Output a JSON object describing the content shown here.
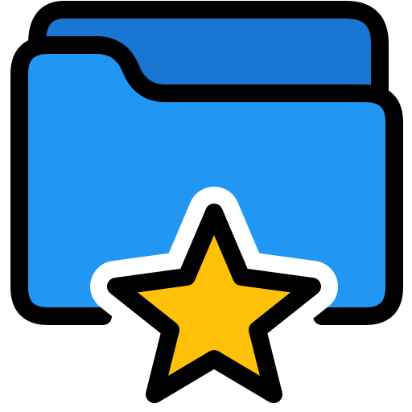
{
  "icon": {
    "name": "folder-star-icon",
    "parts": [
      "back-folder-panel",
      "front-folder",
      "star"
    ]
  },
  "colors": {
    "folder_back": "#1976D2",
    "folder_front": "#2196F3",
    "star_fill": "#FFC107",
    "outline": "#000000",
    "halo": "#FFFFFF"
  }
}
